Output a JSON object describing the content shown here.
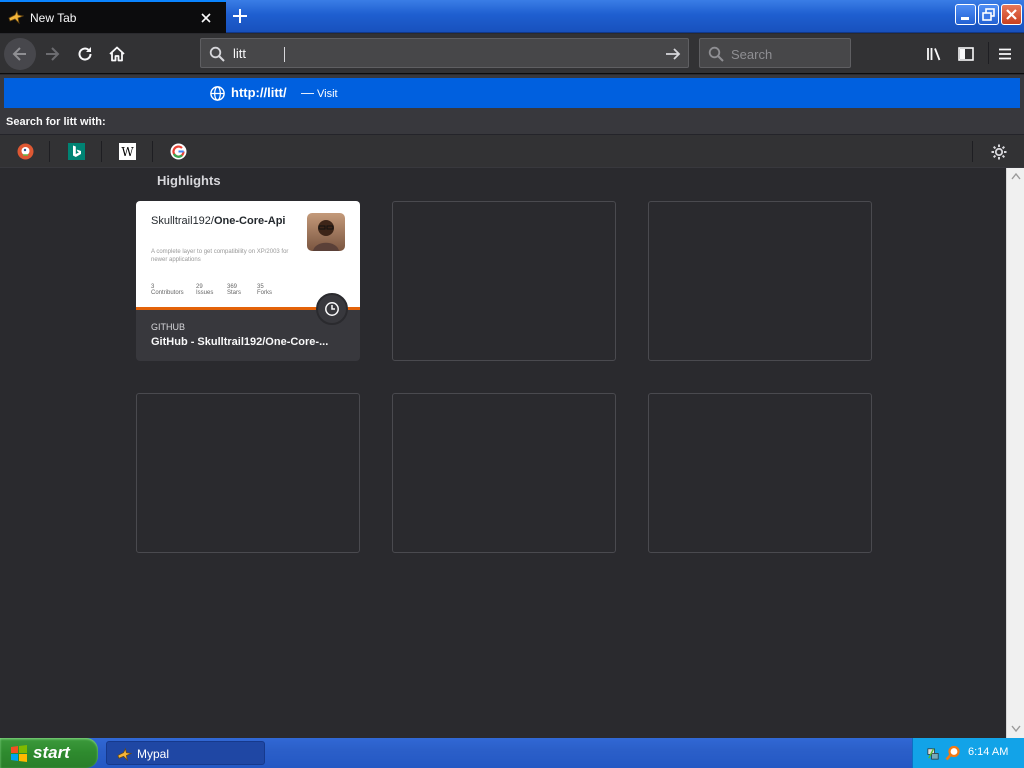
{
  "tab": {
    "title": "New Tab"
  },
  "toolbar": {
    "url_value": "litt",
    "search_placeholder": "Search"
  },
  "dropdown": {
    "suggestion_url": "http://litt/",
    "suggestion_dash": "—",
    "suggestion_action": "Visit",
    "search_with": "Search for litt with:",
    "engines": [
      "duckduckgo-icon",
      "bing-icon",
      "wikipedia-icon",
      "google-icon"
    ]
  },
  "highlights": {
    "title": "Highlights",
    "card": {
      "preview_title_owner": "Skulltrail192/",
      "preview_title_repo": "One-Core-Api",
      "preview_desc": "A complete layer to get compatibility on XP/2003 for newer applications",
      "stats": [
        {
          "value": "3",
          "label": "Contributors"
        },
        {
          "value": "29",
          "label": "Issues"
        },
        {
          "value": "369",
          "label": "Stars"
        },
        {
          "value": "35",
          "label": "Forks"
        }
      ],
      "site_label": "GITHUB",
      "page_title": "GitHub - Skulltrail192/One-Core-..."
    }
  },
  "taskbar": {
    "start_label": "start",
    "task_item": "Mypal",
    "clock": "6:14 AM"
  },
  "colors": {
    "accent": "#0060df",
    "tab_highlight": "#0a84ff",
    "content_bg": "#2a2a2e"
  }
}
